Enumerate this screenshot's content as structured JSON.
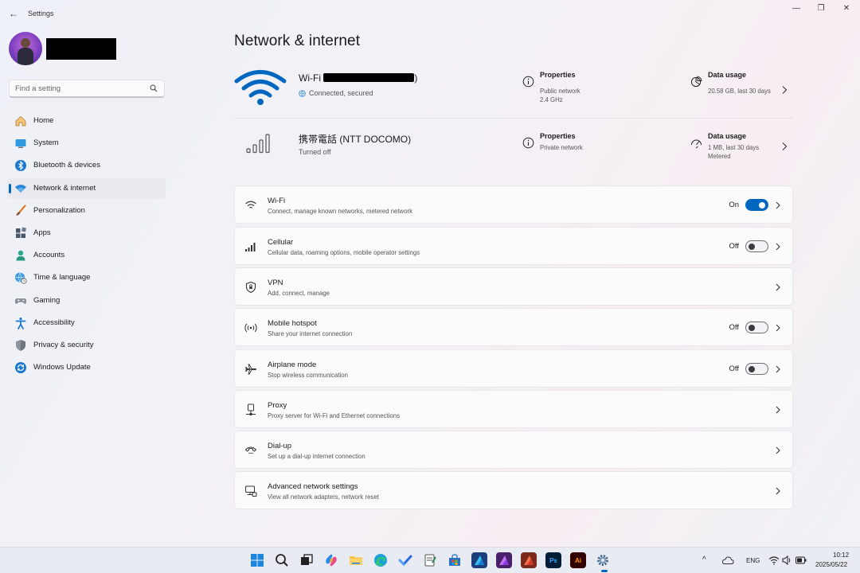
{
  "window": {
    "title": "Settings",
    "back_glyph": "←",
    "minimize_glyph": "—",
    "maximize_glyph": "❐",
    "close_glyph": "✕"
  },
  "profile": {
    "name": "████████"
  },
  "search": {
    "placeholder": "Find a setting",
    "icon": "search-icon"
  },
  "sidebar": {
    "selected_index": 3,
    "items": [
      {
        "label": "Home",
        "icon": "home-icon"
      },
      {
        "label": "System",
        "icon": "system-icon"
      },
      {
        "label": "Bluetooth & devices",
        "icon": "bluetooth-icon"
      },
      {
        "label": "Network & internet",
        "icon": "network-icon"
      },
      {
        "label": "Personalization",
        "icon": "brush-icon"
      },
      {
        "label": "Apps",
        "icon": "apps-icon"
      },
      {
        "label": "Accounts",
        "icon": "accounts-icon"
      },
      {
        "label": "Time & language",
        "icon": "globe-clock-icon"
      },
      {
        "label": "Gaming",
        "icon": "gamepad-icon"
      },
      {
        "label": "Accessibility",
        "icon": "accessibility-icon"
      },
      {
        "label": "Privacy & security",
        "icon": "shield-icon"
      },
      {
        "label": "Windows Update",
        "icon": "update-icon"
      }
    ]
  },
  "page": {
    "title": "Network & internet"
  },
  "wifi_summary": {
    "name_prefix": "Wi-Fi",
    "name_redacted": "████████",
    "name_suffix": ")",
    "status": "Connected, secured",
    "properties": {
      "title": "Properties",
      "line1": "Public network",
      "line2": "2.4 GHz"
    },
    "usage": {
      "title": "Data usage",
      "line1": "20.58 GB, last 30 days"
    }
  },
  "cellular_summary": {
    "name": "携帯電話 (NTT DOCOMO)",
    "status": "Turned off",
    "properties": {
      "title": "Properties",
      "line1": "Private network"
    },
    "usage": {
      "title": "Data usage",
      "line1": "1 MB, last 30 days",
      "line2": "Metered"
    }
  },
  "settings": [
    {
      "title": "Wi-Fi",
      "subtitle": "Connect, manage known networks, metered network",
      "icon": "wifi-icon",
      "state": "On",
      "toggle": "on"
    },
    {
      "title": "Cellular",
      "subtitle": "Cellular data, roaming options, mobile operator settings",
      "icon": "cellular-icon",
      "state": "Off",
      "toggle": "off"
    },
    {
      "title": "VPN",
      "subtitle": "Add, connect, manage",
      "icon": "vpn-shield-icon",
      "state": "",
      "toggle": ""
    },
    {
      "title": "Mobile hotspot",
      "subtitle": "Share your internet connection",
      "icon": "hotspot-icon",
      "state": "Off",
      "toggle": "off"
    },
    {
      "title": "Airplane mode",
      "subtitle": "Stop wireless communication",
      "icon": "airplane-icon",
      "state": "Off",
      "toggle": "off"
    },
    {
      "title": "Proxy",
      "subtitle": "Proxy server for Wi-Fi and Ethernet connections",
      "icon": "proxy-icon",
      "state": "",
      "toggle": ""
    },
    {
      "title": "Dial-up",
      "subtitle": "Set up a dial-up internet connection",
      "icon": "dialup-icon",
      "state": "",
      "toggle": ""
    },
    {
      "title": "Advanced network settings",
      "subtitle": "View all network adapters, network reset",
      "icon": "advanced-network-icon",
      "state": "",
      "toggle": ""
    }
  ],
  "taskbar": {
    "apps": [
      {
        "name": "start-icon",
        "label": ""
      },
      {
        "name": "taskbar-search-icon",
        "label": ""
      },
      {
        "name": "task-view-icon",
        "label": ""
      },
      {
        "name": "copilot-icon",
        "label": ""
      },
      {
        "name": "file-explorer-icon",
        "label": ""
      },
      {
        "name": "edge-icon",
        "label": ""
      },
      {
        "name": "todo-icon",
        "label": ""
      },
      {
        "name": "notepad-icon",
        "label": ""
      },
      {
        "name": "store-icon",
        "label": ""
      },
      {
        "name": "affinity-designer-icon",
        "label": ""
      },
      {
        "name": "affinity-photo-icon",
        "label": ""
      },
      {
        "name": "affinity-publisher-icon",
        "label": ""
      },
      {
        "name": "photoshop-icon",
        "label": "Ps"
      },
      {
        "name": "illustrator-icon",
        "label": "Ai"
      },
      {
        "name": "settings-gear-icon",
        "label": ""
      }
    ],
    "tray": {
      "chevron": "^",
      "language": "ENG",
      "time": "10:12",
      "date": "2025/05/22"
    }
  }
}
